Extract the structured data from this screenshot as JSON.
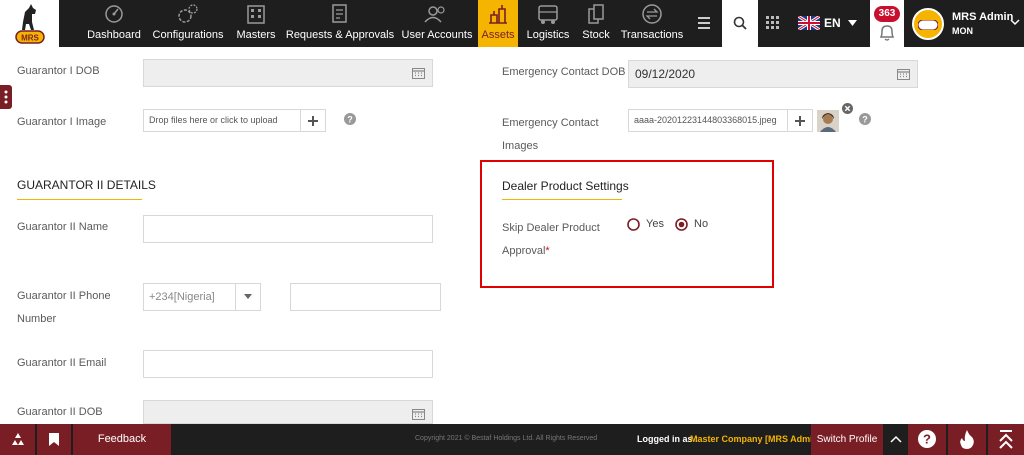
{
  "nav": {
    "items": [
      {
        "label": "Dashboard",
        "icon": "dashboard-icon"
      },
      {
        "label": "Configurations",
        "icon": "gears-icon"
      },
      {
        "label": "Masters",
        "icon": "building-icon"
      },
      {
        "label": "Requests & Approvals",
        "icon": "document-icon"
      },
      {
        "label": "User Accounts",
        "icon": "users-icon"
      },
      {
        "label": "Assets",
        "icon": "assets-icon",
        "active": true
      },
      {
        "label": "Logistics",
        "icon": "truck-icon"
      },
      {
        "label": "Stock",
        "icon": "stock-icon"
      },
      {
        "label": "Transactions",
        "icon": "exchange-icon"
      }
    ],
    "language": "EN",
    "notification_count": "363",
    "user_name": "MRS Admin",
    "user_role": "MON",
    "logo_text": "MRS"
  },
  "form": {
    "guarantor1_dob_label": "Guarantor I DOB",
    "guarantor1_image_label": "Guarantor I Image",
    "guarantor1_image_placeholder": "Drop files here or click to upload",
    "emergency_dob_label": "Emergency Contact DOB",
    "emergency_dob_value": "09/12/2020",
    "emergency_images_label_1": "Emergency Contact",
    "emergency_images_label_2": "Images",
    "emergency_image_file": "aaaa-20201223144803368015.jpeg",
    "guarantor2_header": "GUARANTOR II DETAILS",
    "guarantor2_name_label": "Guarantor II Name",
    "guarantor2_phone_label_1": "Guarantor II Phone",
    "guarantor2_phone_label_2": "Number",
    "guarantor2_phone_code": "+234[Nigeria]",
    "guarantor2_email_label": "Guarantor II Email",
    "guarantor2_dob_label": "Guarantor II DOB"
  },
  "dealer": {
    "header": "Dealer Product Settings",
    "skip_label_1": "Skip Dealer Product",
    "skip_label_2": "Approval",
    "required_mark": "*",
    "option_yes": "Yes",
    "option_no": "No",
    "selected": "No"
  },
  "footer": {
    "feedback": "Feedback",
    "copyright": "Copyright 2021 © Bestaf Holdings Ltd. All Rights Reserved",
    "logged_in_label": "Logged in as :",
    "logged_in_value": "Master Company [MRS Admin]",
    "switch_profile": "Switch Profile"
  },
  "colors": {
    "accent": "#7a1e26",
    "highlight": "#f4b400",
    "topbar": "#1e1e1e",
    "annotation": "#e00000"
  }
}
